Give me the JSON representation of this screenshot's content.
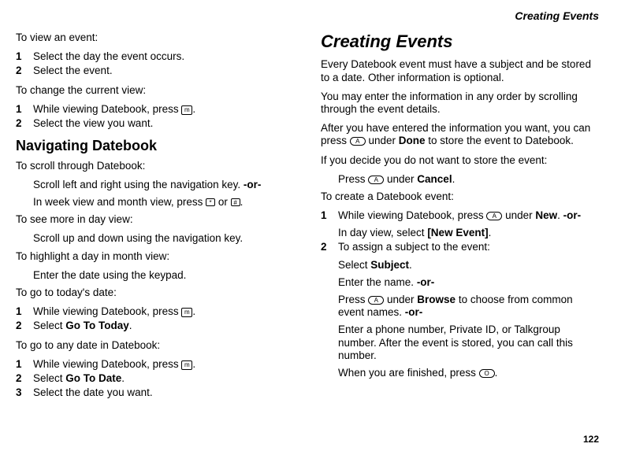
{
  "runningHeader": "Creating Events",
  "pageNumber": "122",
  "left": {
    "viewEventIntro": "To view an event:",
    "viewEventSteps": [
      "Select the day the event occurs.",
      "Select the event."
    ],
    "changeViewIntro": "To change the current view:",
    "changeViewStep1a": "While viewing Datebook, press ",
    "changeViewStep1b": ".",
    "changeViewStep2": "Select the view you want.",
    "navHeading": "Navigating Datebook",
    "scrollIntro": "To scroll through Datebook:",
    "scrollLine1a": "Scroll left and right using the navigation key. ",
    "or": "-or-",
    "scrollLine2a": "In week view and month view, press ",
    "scrollLine2b": " or ",
    "scrollLine2c": ".",
    "moreDayIntro": "To see more in day view:",
    "moreDayLine": "Scroll up and down using the navigation key.",
    "highlightIntro": "To highlight a day in month view:",
    "highlightLine": "Enter the date using the keypad.",
    "todayIntro": "To go to today's date:",
    "todayStep1a": "While viewing Datebook, press ",
    "todayStep1b": ".",
    "todayStep2a": "Select ",
    "todayStep2b": "Go To Today",
    "todayStep2c": ".",
    "anyDateIntro": "To go to any date in Datebook:",
    "anyDateStep1a": "While viewing Datebook, press ",
    "anyDateStep1b": ".",
    "anyDateStep2a": "Select ",
    "anyDateStep2b": "Go To Date",
    "anyDateStep2c": ".",
    "anyDateStep3": "Select the date you want."
  },
  "right": {
    "heading": "Creating Events",
    "p1": "Every Datebook event must have a subject and be stored to a date. Other information is optional.",
    "p2": "You may enter the information in any order by scrolling through the event details.",
    "p3a": "After you have entered the information you want, you can press ",
    "p3b": " under ",
    "done": "Done",
    "p3c": " to store the event to Datebook.",
    "decideIntro": "If you decide you do not want to store the event:",
    "decideLineA": "Press ",
    "decideLineB": " under ",
    "cancel": "Cancel",
    "decideLineC": ".",
    "createIntro": "To create a Datebook event:",
    "c1a": "While viewing Datebook, press ",
    "c1b": " under ",
    "new": "New",
    "c1c": ". ",
    "c1d": "In day view, select ",
    "newEvent": "[New Event]",
    "c1e": ".",
    "c2": "To assign a subject to the event:",
    "c2selA": "Select ",
    "subject": "Subject",
    "c2selB": ".",
    "c2nameA": "Enter the name. ",
    "c2browseA": "Press ",
    "c2browseB": " under ",
    "browse": "Browse",
    "c2browseC": " to choose from common event names. ",
    "c2phone": "Enter a phone number, Private ID, or Talkgroup number. After the event is stored, you can call this number.",
    "c2finishA": "When you are finished, press ",
    "c2finishB": "."
  },
  "glyphs": {
    "menu": "m",
    "star": "*",
    "hash": "#",
    "softA": "A",
    "ok": "O"
  }
}
